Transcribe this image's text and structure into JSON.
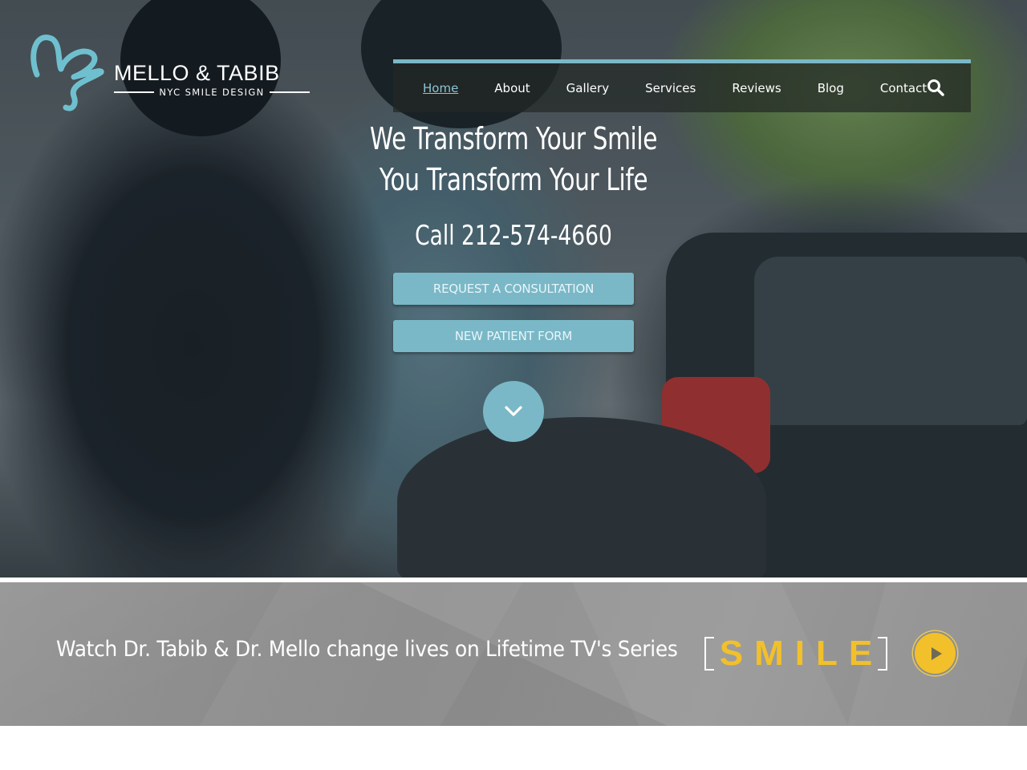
{
  "brand": {
    "name": "MELLO & TABIB",
    "tagline": "NYC SMILE DESIGN",
    "accent_color": "#7ab8c7",
    "highlight_color": "#f2c02a"
  },
  "nav": {
    "items": [
      {
        "label": "Home",
        "active": true
      },
      {
        "label": "About",
        "active": false
      },
      {
        "label": "Gallery",
        "active": false
      },
      {
        "label": "Services",
        "active": false
      },
      {
        "label": "Reviews",
        "active": false
      },
      {
        "label": "Blog",
        "active": false
      },
      {
        "label": "Contact",
        "active": false
      }
    ],
    "search_icon": "search-icon"
  },
  "hero": {
    "headline_line1": "We Transform Your Smile",
    "headline_line2": "You Transform Your Life",
    "phone": "Call 212-574-4660",
    "buttons": {
      "consultation": "REQUEST A CONSULTATION",
      "patient_form": "NEW PATIENT FORM"
    },
    "scroll_icon": "chevron-down-icon"
  },
  "smile_band": {
    "text": "Watch Dr. Tabib & Dr. Mello change lives on Lifetime TV's Series",
    "series_logo": "SMILE",
    "play_icon": "play-icon"
  }
}
